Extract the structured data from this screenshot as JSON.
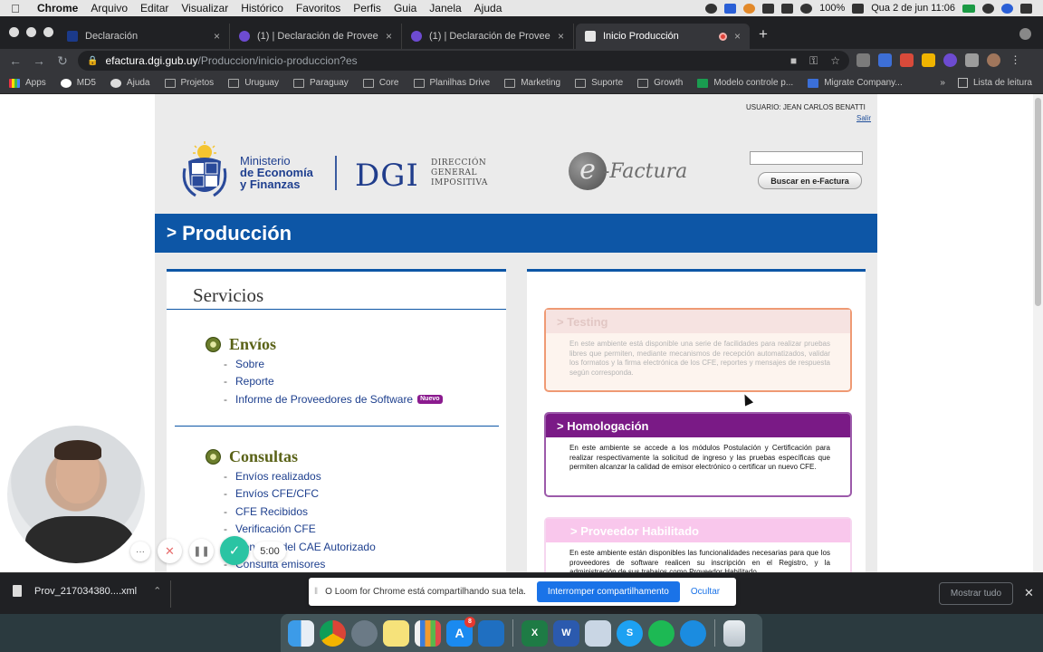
{
  "menubar": {
    "apple": "",
    "items": [
      "Chrome",
      "Arquivo",
      "Editar",
      "Visualizar",
      "Histórico",
      "Favoritos",
      "Perfis",
      "Guia",
      "Janela",
      "Ajuda"
    ],
    "battery": "100%",
    "datetime": "Qua 2 de jun  11:06"
  },
  "tabs": [
    {
      "title": "Declaración",
      "close": "×"
    },
    {
      "title": "(1) | Declaración de Proveedor",
      "close": "×"
    },
    {
      "title": "(1) | Declaración de Proveedor",
      "close": "×"
    },
    {
      "title": "Inicio Producción",
      "close": "×"
    }
  ],
  "toolbar": {
    "host": "efactura.dgi.gub.uy",
    "path": "/Produccion/inicio-produccion?es"
  },
  "bookmarks": {
    "items": [
      "Apps",
      "MD5",
      "Ajuda",
      "Projetos",
      "Uruguay",
      "Paraguay",
      "Core",
      "Planilhas Drive",
      "Marketing",
      "Suporte",
      "Growth",
      "Modelo controle p...",
      "Migrate Company..."
    ],
    "more": "»",
    "reading_list": "Lista de leitura"
  },
  "page": {
    "user_label": "USUARIO: JEAN CARLOS BENATTI",
    "logout": "Salir",
    "ministry_line1": "Ministerio",
    "ministry_line2": "de Economía",
    "ministry_line3": "y Finanzas",
    "dgi": "DGI",
    "dgi_sub1": "DIRECCIÓN",
    "dgi_sub2": "GENERAL",
    "dgi_sub3": "IMPOSITIVA",
    "efactura_e": "e",
    "efactura_rest": "-Factura",
    "search_value": "",
    "search_button": "Buscar en e-Factura",
    "banner_chevron": ">",
    "banner_title": "Producción",
    "services_title": "Servicios",
    "envios": {
      "title": "Envíos",
      "links": [
        "Sobre",
        "Reporte",
        "Informe de Proveedores de Software"
      ],
      "new_badge": "Nuevo"
    },
    "consultas": {
      "title": "Consultas",
      "links": [
        "Envíos realizados",
        "Envíos CFE/CFC",
        "CFE Recibidos",
        "Verificación CFE",
        "Consulta del CAE Autorizado",
        "Consulta emisores"
      ]
    },
    "environments": [
      {
        "title": "> Testing",
        "body": "En este ambiente está disponible una serie de facilidades para realizar pruebas libres que permiten, mediante mecanismos de recepción automatizados, validar los formatos y la firma electrónica de los CFE, reportes y mensajes de respuesta según corresponda."
      },
      {
        "title": "> Homologación",
        "body": "En este ambiente se accede a los módulos Postulación y Certificación para realizar respectivamente la solicitud de ingreso y las pruebas específicas que permiten alcanzar la calidad de emisor electrónico o certificar un nuevo CFE."
      },
      {
        "title": "> Proveedor Habilitado",
        "body": "En este ambiente están disponibles las funcionalidades necesarias para que los proveedores de software realicen su inscripción en el Registro, y la administración de sus trabajos como Proveedor Habilitado."
      }
    ]
  },
  "loom": {
    "more": "···",
    "cancel": "✕",
    "pause": "❚❚",
    "done": "✓",
    "timer": "5:00",
    "notice_text": "O Loom for Chrome está compartilhando sua tela.",
    "stop_button": "Interromper compartilhamento",
    "hide_button": "Ocultar"
  },
  "downloads": {
    "file": "Prov_217034380....xml",
    "show_all": "Mostrar tudo",
    "close": "✕"
  },
  "dock": {
    "appstore_badge": "8"
  },
  "colors": {
    "banner_blue": "#0d56a6",
    "homologacion_purple": "#7a1a86",
    "link_blue": "#1d3f8e",
    "olive": "#5a6217"
  }
}
